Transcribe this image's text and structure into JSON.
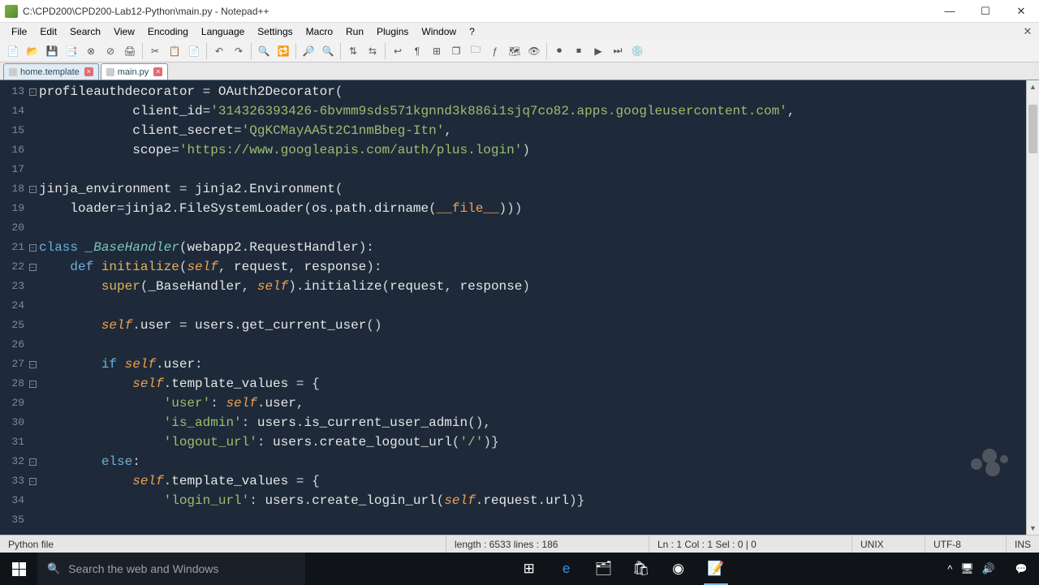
{
  "window": {
    "title": "C:\\CPD200\\CPD200-Lab12-Python\\main.py - Notepad++"
  },
  "menus": [
    "File",
    "Edit",
    "Search",
    "View",
    "Encoding",
    "Language",
    "Settings",
    "Macro",
    "Run",
    "Plugins",
    "Window",
    "?"
  ],
  "tabs": [
    {
      "label": "home.template",
      "active": false
    },
    {
      "label": "main.py",
      "active": true
    }
  ],
  "line_numbers": [
    13,
    14,
    15,
    16,
    17,
    18,
    19,
    20,
    21,
    22,
    23,
    24,
    25,
    26,
    27,
    28,
    29,
    30,
    31,
    32,
    33,
    34,
    35
  ],
  "fold_markers": {
    "13": "minus",
    "18": "minus",
    "21": "minus",
    "22": "minus",
    "27": "minus",
    "28": "minus",
    "32": "minus",
    "33": "minus"
  },
  "code_lines": [
    [
      [
        "id",
        "profileauthdecorator "
      ],
      [
        "op",
        "= "
      ],
      [
        "id",
        "OAuth2Decorator"
      ],
      [
        "par",
        "("
      ]
    ],
    [
      [
        "id",
        "            client_id"
      ],
      [
        "op",
        "="
      ],
      [
        "str",
        "'314326393426-6bvmm9sds571kgnnd3k886i1sjq7co82.apps.googleusercontent.com'"
      ],
      [
        "op",
        ","
      ]
    ],
    [
      [
        "id",
        "            client_secret"
      ],
      [
        "op",
        "="
      ],
      [
        "str",
        "'QgKCMayAA5t2C1nmBbeg-Itn'"
      ],
      [
        "op",
        ","
      ]
    ],
    [
      [
        "id",
        "            scope"
      ],
      [
        "op",
        "="
      ],
      [
        "str",
        "'https://www.googleapis.com/auth/plus.login'"
      ],
      [
        "par",
        ")"
      ]
    ],
    [],
    [
      [
        "id",
        "jinja_environment "
      ],
      [
        "op",
        "= "
      ],
      [
        "id",
        "jinja2"
      ],
      [
        "op",
        "."
      ],
      [
        "id",
        "Environment"
      ],
      [
        "par",
        "("
      ]
    ],
    [
      [
        "id",
        "    loader"
      ],
      [
        "op",
        "="
      ],
      [
        "id",
        "jinja2"
      ],
      [
        "op",
        "."
      ],
      [
        "id",
        "FileSystemLoader"
      ],
      [
        "par",
        "("
      ],
      [
        "id",
        "os"
      ],
      [
        "op",
        "."
      ],
      [
        "id",
        "path"
      ],
      [
        "op",
        "."
      ],
      [
        "id",
        "dirname"
      ],
      [
        "par",
        "("
      ],
      [
        "dund",
        "__file__"
      ],
      [
        "par",
        ")))"
      ]
    ],
    [],
    [
      [
        "kw",
        "class "
      ],
      [
        "cls",
        "_BaseHandler"
      ],
      [
        "par",
        "("
      ],
      [
        "id",
        "webapp2"
      ],
      [
        "op",
        "."
      ],
      [
        "id",
        "RequestHandler"
      ],
      [
        "par",
        ")"
      ],
      [
        "op",
        ":"
      ]
    ],
    [
      [
        "kw",
        "    def "
      ],
      [
        "fn",
        "initialize"
      ],
      [
        "par",
        "("
      ],
      [
        "slf",
        "self"
      ],
      [
        "op",
        ", "
      ],
      [
        "id",
        "request"
      ],
      [
        "op",
        ", "
      ],
      [
        "id",
        "response"
      ],
      [
        "par",
        ")"
      ],
      [
        "op",
        ":"
      ]
    ],
    [
      [
        "id",
        "        "
      ],
      [
        "fn",
        "super"
      ],
      [
        "par",
        "("
      ],
      [
        "id",
        "_BaseHandler"
      ],
      [
        "op",
        ", "
      ],
      [
        "slf",
        "self"
      ],
      [
        "par",
        ")"
      ],
      [
        "op",
        "."
      ],
      [
        "id",
        "initialize"
      ],
      [
        "par",
        "("
      ],
      [
        "id",
        "request"
      ],
      [
        "op",
        ", "
      ],
      [
        "id",
        "response"
      ],
      [
        "par",
        ")"
      ]
    ],
    [],
    [
      [
        "id",
        "        "
      ],
      [
        "slf",
        "self"
      ],
      [
        "op",
        "."
      ],
      [
        "id",
        "user "
      ],
      [
        "op",
        "= "
      ],
      [
        "id",
        "users"
      ],
      [
        "op",
        "."
      ],
      [
        "id",
        "get_current_user"
      ],
      [
        "par",
        "()"
      ]
    ],
    [],
    [
      [
        "id",
        "        "
      ],
      [
        "kw",
        "if "
      ],
      [
        "slf",
        "self"
      ],
      [
        "op",
        "."
      ],
      [
        "id",
        "user"
      ],
      [
        "op",
        ":"
      ]
    ],
    [
      [
        "id",
        "            "
      ],
      [
        "slf",
        "self"
      ],
      [
        "op",
        "."
      ],
      [
        "id",
        "template_values "
      ],
      [
        "op",
        "= "
      ],
      [
        "par",
        "{"
      ]
    ],
    [
      [
        "id",
        "                "
      ],
      [
        "str",
        "'user'"
      ],
      [
        "op",
        ": "
      ],
      [
        "slf",
        "self"
      ],
      [
        "op",
        "."
      ],
      [
        "id",
        "user"
      ],
      [
        "op",
        ","
      ]
    ],
    [
      [
        "id",
        "                "
      ],
      [
        "str",
        "'is_admin'"
      ],
      [
        "op",
        ": "
      ],
      [
        "id",
        "users"
      ],
      [
        "op",
        "."
      ],
      [
        "id",
        "is_current_user_admin"
      ],
      [
        "par",
        "()"
      ],
      [
        "op",
        ","
      ]
    ],
    [
      [
        "id",
        "                "
      ],
      [
        "str",
        "'logout_url'"
      ],
      [
        "op",
        ": "
      ],
      [
        "id",
        "users"
      ],
      [
        "op",
        "."
      ],
      [
        "id",
        "create_logout_url"
      ],
      [
        "par",
        "("
      ],
      [
        "str",
        "'/'"
      ],
      [
        "par",
        ")"
      ],
      [
        "par",
        "}"
      ]
    ],
    [
      [
        "id",
        "        "
      ],
      [
        "kw",
        "else"
      ],
      [
        "op",
        ":"
      ]
    ],
    [
      [
        "id",
        "            "
      ],
      [
        "slf",
        "self"
      ],
      [
        "op",
        "."
      ],
      [
        "id",
        "template_values "
      ],
      [
        "op",
        "= "
      ],
      [
        "par",
        "{"
      ]
    ],
    [
      [
        "id",
        "                "
      ],
      [
        "str",
        "'login_url'"
      ],
      [
        "op",
        ": "
      ],
      [
        "id",
        "users"
      ],
      [
        "op",
        "."
      ],
      [
        "id",
        "create_login_url"
      ],
      [
        "par",
        "("
      ],
      [
        "slf",
        "self"
      ],
      [
        "op",
        "."
      ],
      [
        "id",
        "request"
      ],
      [
        "op",
        "."
      ],
      [
        "id",
        "url"
      ],
      [
        "par",
        ")"
      ],
      [
        "par",
        "}"
      ]
    ],
    []
  ],
  "statusbar": {
    "filetype": "Python file",
    "length": "length : 6533    lines : 186",
    "pos": "Ln : 1    Col : 1    Sel : 0 | 0",
    "eol": "UNIX",
    "enc": "UTF-8",
    "ovr": "INS"
  },
  "taskbar": {
    "search_placeholder": "Search the web and Windows"
  }
}
